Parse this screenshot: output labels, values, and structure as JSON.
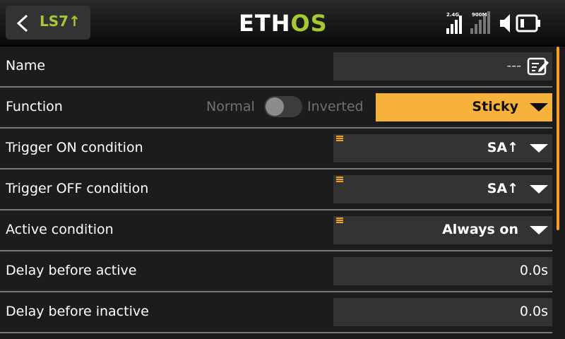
{
  "header": {
    "title": "LS7↑",
    "logo_left": "ETH",
    "logo_right": "OS",
    "rf_2g4_label": "2.4G",
    "rf_900m_label": "900M",
    "back_icon": "chevron-left-icon",
    "speaker_icon": "speaker-icon",
    "battery_icon": "battery-icon"
  },
  "rows": {
    "name": {
      "label": "Name",
      "value": "---",
      "icon": "edit-icon"
    },
    "function": {
      "label": "Function",
      "option_normal": "Normal",
      "option_inverted": "Inverted",
      "value": "Sticky"
    },
    "trigger_on": {
      "label": "Trigger ON condition",
      "value": "SA↑"
    },
    "trigger_off": {
      "label": "Trigger OFF condition",
      "value": "SA↑"
    },
    "active": {
      "label": "Active condition",
      "value": "Always on"
    },
    "delay_active": {
      "label": "Delay before active",
      "value": "0.0s"
    },
    "delay_inactive": {
      "label": "Delay before inactive",
      "value": "0.0s"
    }
  },
  "colors": {
    "accent": "#f7b23b",
    "title_green": "#a4c931",
    "menu_orange": "#f6a020"
  }
}
